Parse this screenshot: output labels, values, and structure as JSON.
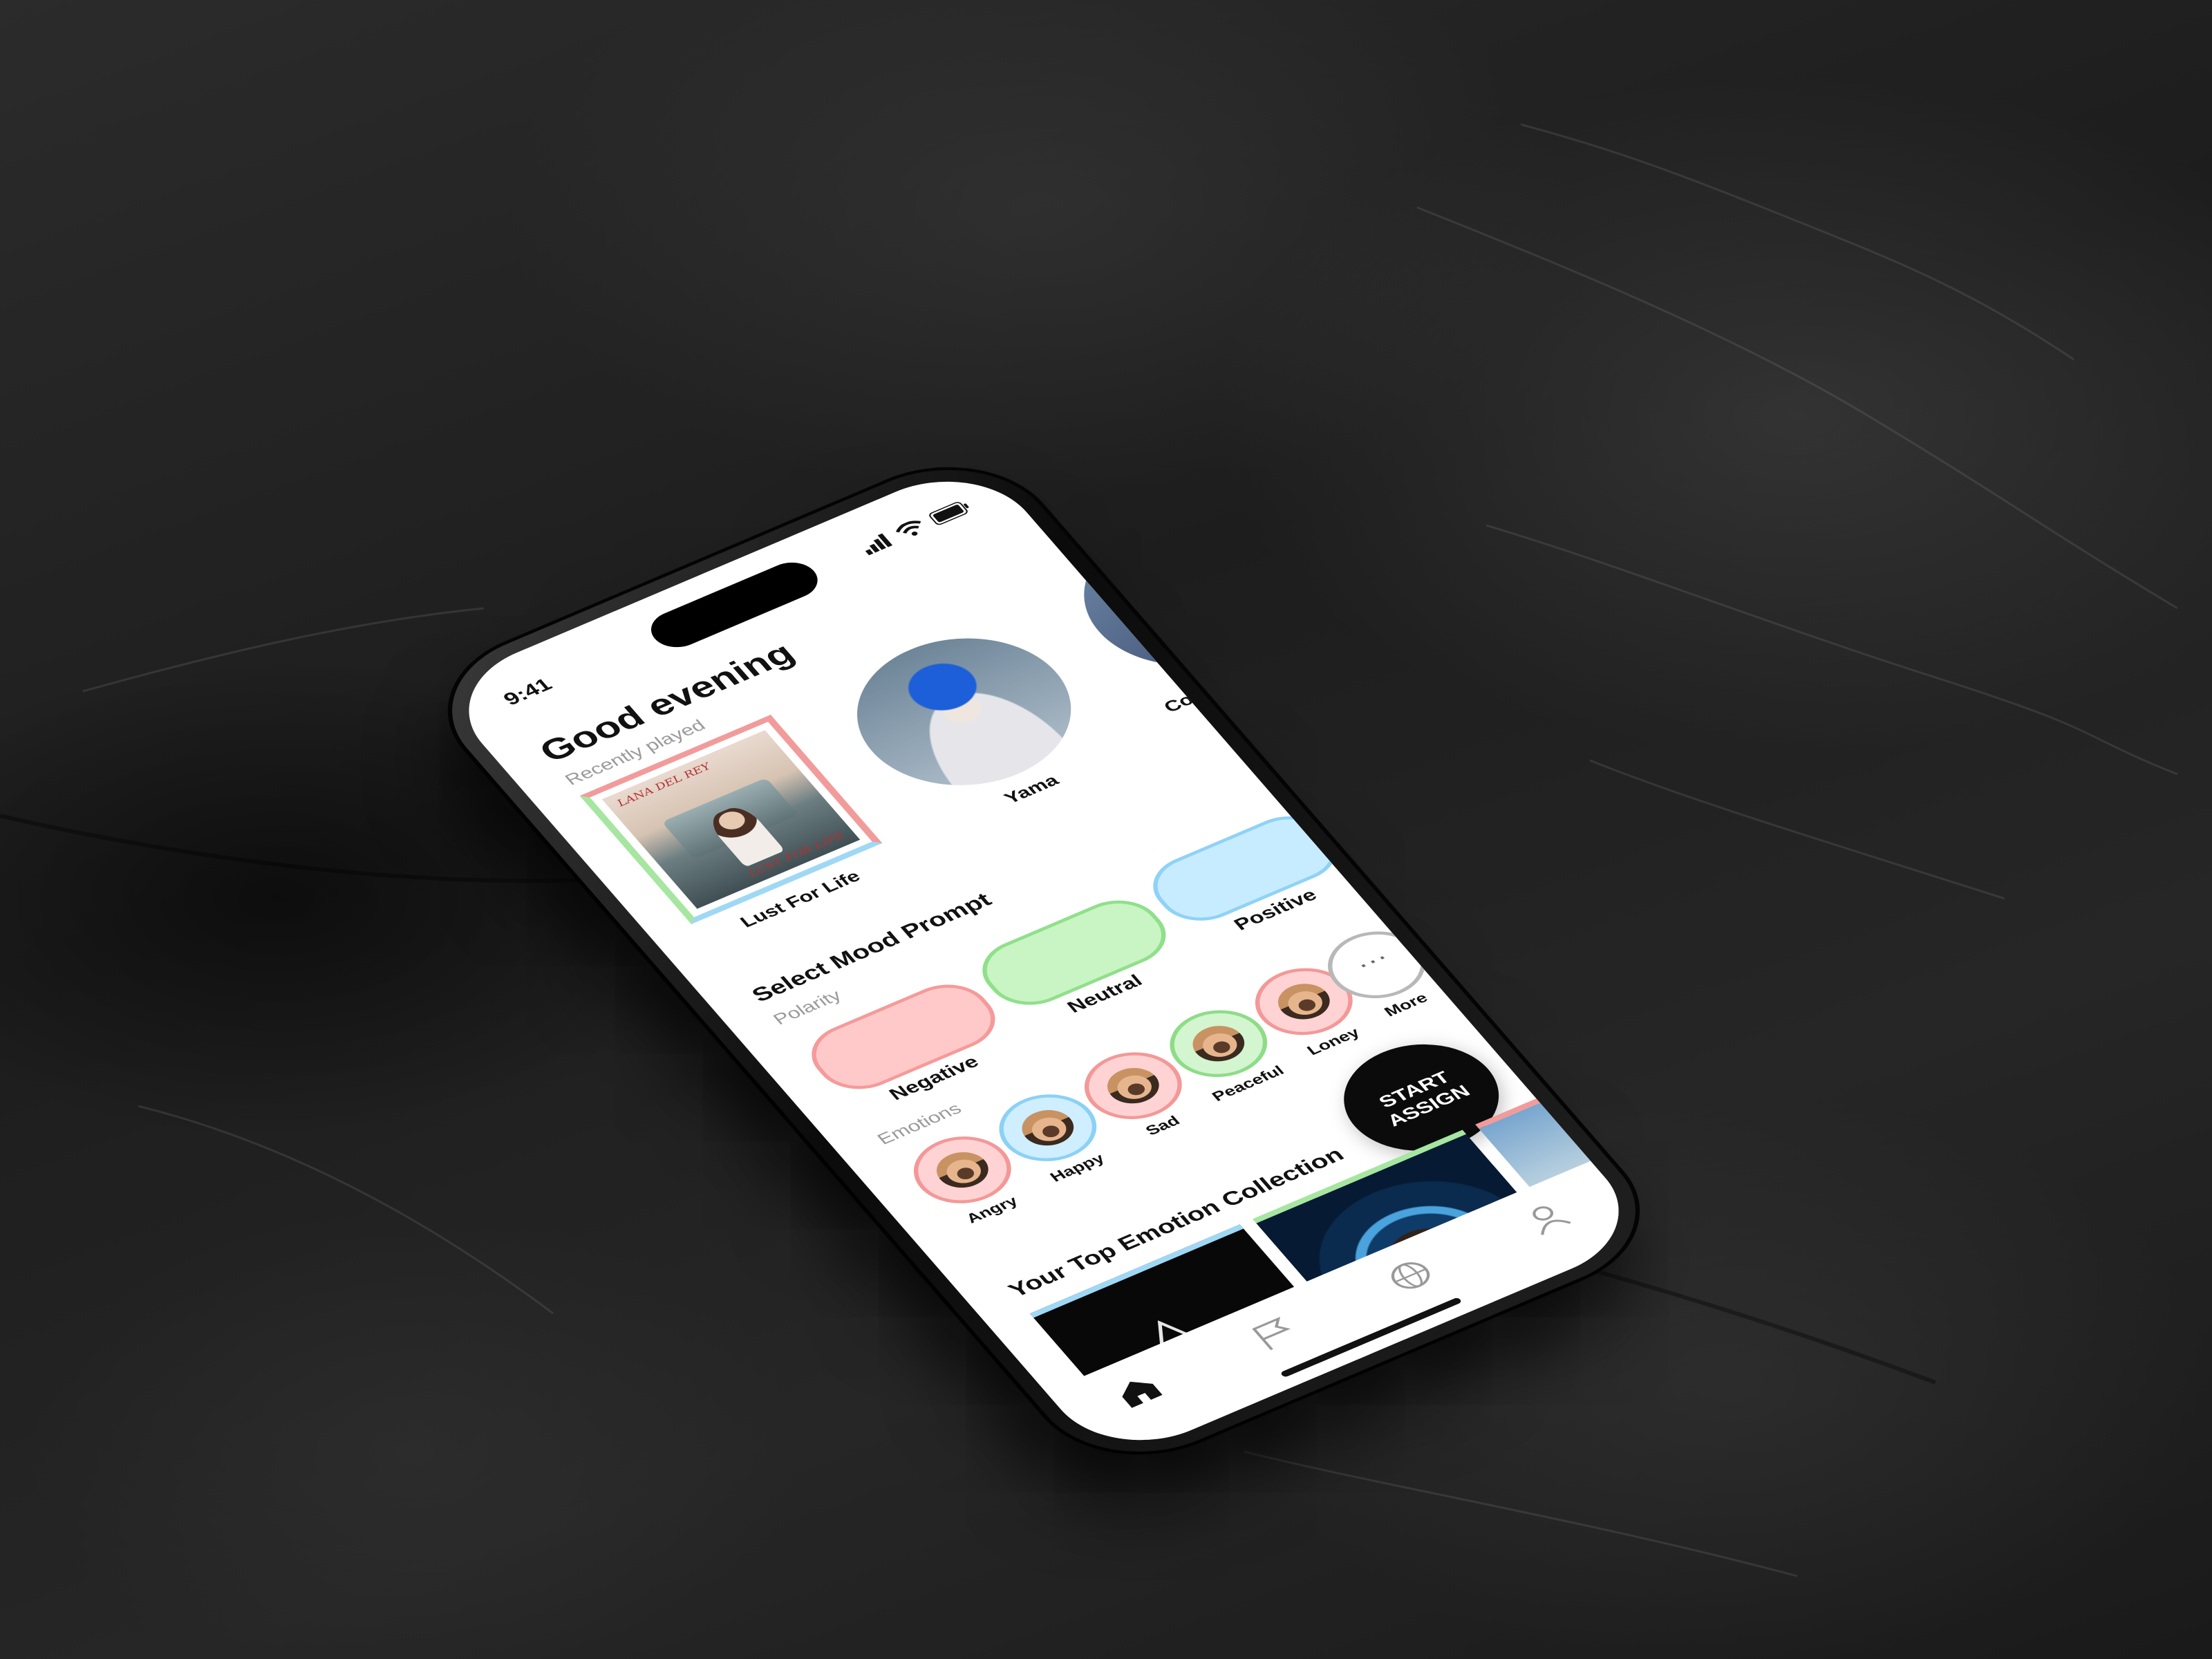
{
  "status_bar": {
    "time": "9:41"
  },
  "home": {
    "greeting": "Good evening",
    "recently_played_label": "Recently played",
    "recently_played": [
      {
        "label": "Lust For Life",
        "type": "album"
      },
      {
        "label": "Yama",
        "type": "artist"
      },
      {
        "label": "Cold",
        "type": "artist"
      }
    ],
    "album_logo_top": "LANA DEL REY",
    "album_logo_bottom": "LUST FOR LIFE"
  },
  "mood_prompt": {
    "title": "Select Mood Prompt",
    "polarity_label": "Polarity",
    "polarities": [
      {
        "label": "Negative",
        "color": "#ffc9c9"
      },
      {
        "label": "Neutral",
        "color": "#c9f4c4"
      },
      {
        "label": "Positive",
        "color": "#c8ecff"
      }
    ],
    "emotions_label": "Emotions",
    "emotions": [
      {
        "label": "Angry",
        "color": "#ffd3d3"
      },
      {
        "label": "Happy",
        "color": "#cfeeff"
      },
      {
        "label": "Sad",
        "color": "#ffd3d3"
      },
      {
        "label": "Peaceful",
        "color": "#d3f5cf"
      },
      {
        "label": "Loney",
        "color": "#ffd3d3"
      },
      {
        "label": "More",
        "color": "#ffffff"
      }
    ],
    "more_glyph": "···"
  },
  "cta": {
    "line1": "START",
    "line2": "ASSIGN"
  },
  "collection": {
    "title": "Your Top Emotion Collection"
  },
  "tab_bar": {
    "items": [
      {
        "icon": "home-icon",
        "active": true
      },
      {
        "icon": "flag-icon",
        "active": false
      },
      {
        "icon": "globe-icon",
        "active": false
      },
      {
        "icon": "profile-icon",
        "active": false
      }
    ]
  },
  "colors": {
    "negative": "#f59a9a",
    "neutral": "#8fe08a",
    "positive": "#8fd2f7",
    "cta_background": "#0b0b0b"
  }
}
